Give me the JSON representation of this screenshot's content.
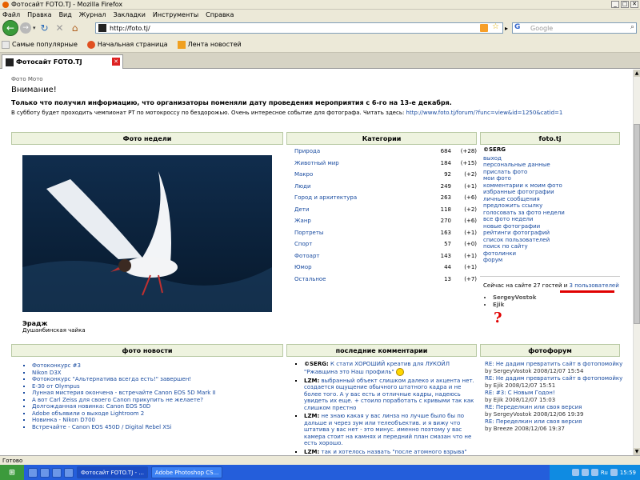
{
  "window": {
    "title": "Фотосайт FOTO.TJ - Mozilla Firefox"
  },
  "menu": [
    "Файл",
    "Правка",
    "Вид",
    "Журнал",
    "Закладки",
    "Инструменты",
    "Справка"
  ],
  "address": {
    "url": "http://foto.tj/"
  },
  "search": {
    "placeholder": "Google"
  },
  "bookmarks": [
    "Самые популярные",
    "Начальная страница",
    "Лента новостей"
  ],
  "tab": {
    "label": "Фотосайт FOTO.TJ"
  },
  "page": {
    "crumb": "Фото Мото",
    "alert_title": "Внимание!",
    "alert_body": "Только что получил информацию, что организаторы поменяли дату проведения мероприятия с 6-го на 13-е декабря.",
    "alert_body2": "В субботу будет проходить чемпионат РТ по мотокроссу по бездорожью. Очень интересное событие для фотографа. Читать здесь:",
    "alert_link": "http://www.foto.tj/forum/?func=view&id=1250&catid=1"
  },
  "photo_week": {
    "header": "Фото недели",
    "title": "Эрадж",
    "subtitle": "Душанбинская чайка"
  },
  "categories": {
    "header": "Категории",
    "rows": [
      {
        "name": "Природа",
        "count": "684",
        "delta": "(+28)"
      },
      {
        "name": "Животный мир",
        "count": "184",
        "delta": "(+15)"
      },
      {
        "name": "Макро",
        "count": "92",
        "delta": "(+2)"
      },
      {
        "name": "Люди",
        "count": "249",
        "delta": "(+1)"
      },
      {
        "name": "Город и архитектура",
        "count": "263",
        "delta": "(+6)"
      },
      {
        "name": "Дети",
        "count": "118",
        "delta": "(+2)"
      },
      {
        "name": "Жанр",
        "count": "270",
        "delta": "(+6)"
      },
      {
        "name": "Портреты",
        "count": "163",
        "delta": "(+1)"
      },
      {
        "name": "Спорт",
        "count": "57",
        "delta": "(+0)"
      },
      {
        "name": "Фотоарт",
        "count": "143",
        "delta": "(+1)"
      },
      {
        "name": "Юмор",
        "count": "44",
        "delta": "(+1)"
      },
      {
        "name": "Остальное",
        "count": "13",
        "delta": "(+7)"
      }
    ]
  },
  "site_menu": {
    "header": "foto.tj",
    "user": "©SERG",
    "items": [
      "выход",
      "персональные данные",
      "прислать фото",
      "мои фото",
      "комментарии к моим фото",
      "избранные фотографии",
      "личные сообщения",
      "предложить ссылку",
      "голосовать за фото недели",
      "все фото недели",
      "новые фотографии",
      "рейтинги фотографий",
      "список пользователей",
      "поиск по сайту",
      "фотолинки",
      "форум"
    ]
  },
  "online": {
    "text": "Сейчас на сайте 27 гостей и ",
    "users_link": "3 пользователей",
    "users": [
      "SergeyVostok",
      "Ejik"
    ]
  },
  "news": {
    "header": "фото новости",
    "items": [
      "Фотоконкурс #3",
      "Nikon D3X",
      "Фотоконкурс \"Альтернатива всегда есть!\" завершен!",
      "E-30 от Olympus",
      "Лунная мистерия окончена - встречайте Canon EOS 5D Mark II",
      "А вот Carl Zeiss для своего Canon прикупить не желаете?",
      "Долгожданная новинка: Canon EOS 50D",
      "Adobe объявили о выходе Lightroom 2",
      "Новинка - Nikon D700",
      "Встречайте - Canon EOS 450D / Digital Rebel XSi"
    ]
  },
  "comments": {
    "header": "последние комментарии",
    "items": [
      {
        "author": "©SERG:",
        "text": "К стати ХОРОШИЙ креатив для ЛУКОЙЛ \"Ржавщина это Наш профиль\""
      },
      {
        "author": "LZM:",
        "text": "выбранный объект слишком далеко и акцента нет. создается ощущение обычного штатного кадра и не более того. А у вас есть и отличные кадры, надеюсь увидеть их еще. + стоило поработать с кривыми так как слишком престно"
      },
      {
        "author": "LZM:",
        "text": "не знаю какая у вас линза но лучше было бы по дальше и через зум или телеобъектив. и я вижу что штатива у вас нет - это минус. именно поэтому у вас камера стоит на камнях и передний план смазан что не есть хорошо."
      },
      {
        "author": "LZM:",
        "text": "так и хотелось назвать \"после атомного взрыва\" или"
      }
    ]
  },
  "forum": {
    "header": "фотофорум",
    "items": [
      {
        "title": "RE: Не дадим превратить сайт в фотопомойку",
        "by": "by SergeyVostok 2008/12/07 15:54"
      },
      {
        "title": "RE: Не дадим превратить сайт в фотопомойку",
        "by": "by Ejik 2008/12/07 15:51"
      },
      {
        "title": "RE: #3: С Новым Годон!",
        "by": "by Ejik 2008/12/07 15:03"
      },
      {
        "title": "RE: Переделкин или своя версия",
        "by": "by SergeyVostok 2008/12/06 19:39"
      },
      {
        "title": "RE: Переделкин или своя версия",
        "by": "by Breeze 2008/12/06 19:37"
      }
    ]
  },
  "status": {
    "text": "Готово"
  },
  "taskbar": {
    "tasks": [
      "Фотосайт FOTO.TJ - ...",
      "Adobe Photoshop CS..."
    ],
    "lang": "Ru",
    "time": "15:59"
  }
}
